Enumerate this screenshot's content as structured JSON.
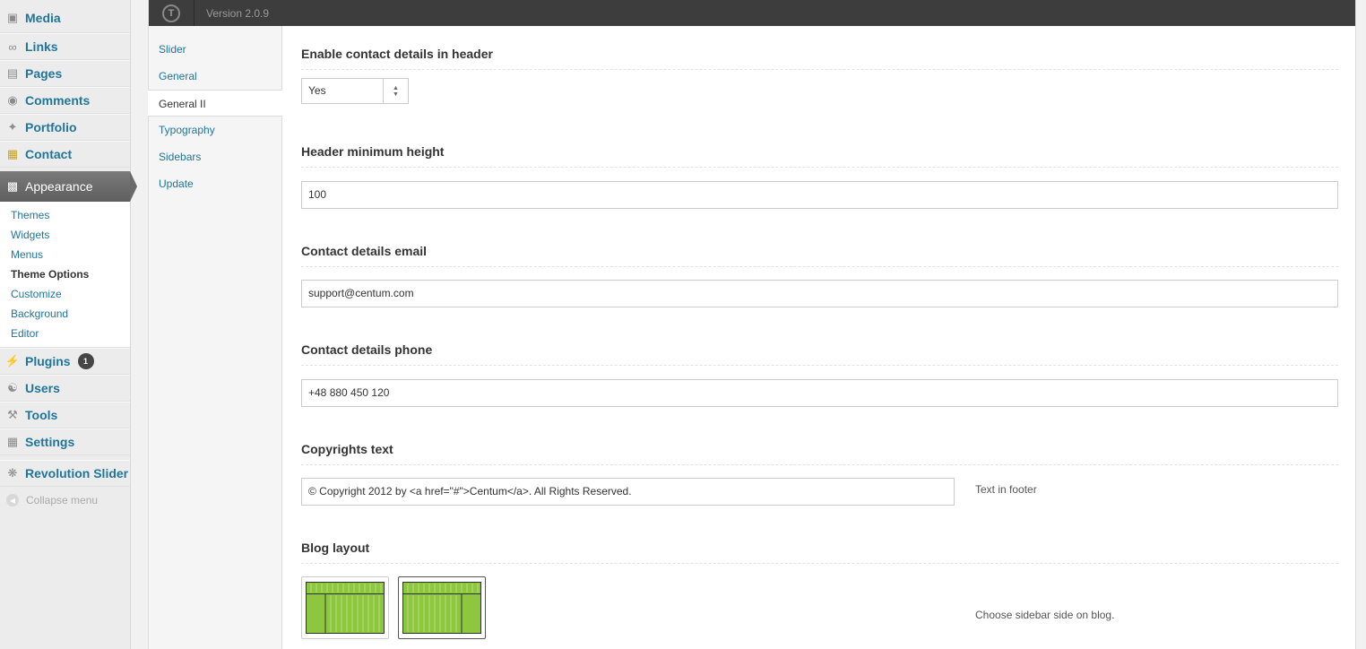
{
  "admin_menu": {
    "items_top": [
      {
        "label": "Media",
        "icon": "media-icon"
      },
      {
        "label": "Links",
        "icon": "links-icon"
      },
      {
        "label": "Pages",
        "icon": "pages-icon"
      },
      {
        "label": "Comments",
        "icon": "comments-icon"
      },
      {
        "label": "Portfolio",
        "icon": "portfolio-icon"
      },
      {
        "label": "Contact",
        "icon": "contact-icon"
      }
    ],
    "appearance": {
      "label": "Appearance",
      "icon": "appearance-icon"
    },
    "appearance_sub": [
      "Themes",
      "Widgets",
      "Menus",
      "Theme Options",
      "Customize",
      "Background",
      "Editor"
    ],
    "current_sub": "Theme Options",
    "items_bottom": [
      {
        "label": "Plugins",
        "icon": "plugins-icon",
        "badge": "1"
      },
      {
        "label": "Users",
        "icon": "users-icon"
      },
      {
        "label": "Tools",
        "icon": "tools-icon"
      },
      {
        "label": "Settings",
        "icon": "settings-icon"
      }
    ],
    "revslider": {
      "label": "Revolution Slider",
      "icon": "revolution-slider-icon"
    },
    "collapse": "Collapse menu"
  },
  "topbar": {
    "version": "Version 2.0.9"
  },
  "tabs": [
    "Slider",
    "General",
    "General II",
    "Typography",
    "Sidebars",
    "Update"
  ],
  "active_tab": "General II",
  "options": {
    "contact_header": {
      "title": "Enable contact details in header",
      "value": "Yes"
    },
    "header_height": {
      "title": "Header minimum height",
      "value": "100"
    },
    "contact_email": {
      "title": "Contact details email",
      "value": "support@centum.com"
    },
    "contact_phone": {
      "title": "Contact details phone",
      "value": "+48 880 450 120"
    },
    "copyrights": {
      "title": "Copyrights text",
      "value": "© Copyright 2012 by <a href=\"#\">Centum</a>. All Rights Reserved.",
      "desc": "Text in footer"
    },
    "blog_layout": {
      "title": "Blog layout",
      "desc": "Choose sidebar side on blog.",
      "options": [
        "left-sidebar",
        "right-sidebar"
      ],
      "selected": "right-sidebar"
    }
  },
  "colors": {
    "link": "#21759b",
    "topbar": "#3d3d3d",
    "thumb_green": "#8dc63f"
  }
}
